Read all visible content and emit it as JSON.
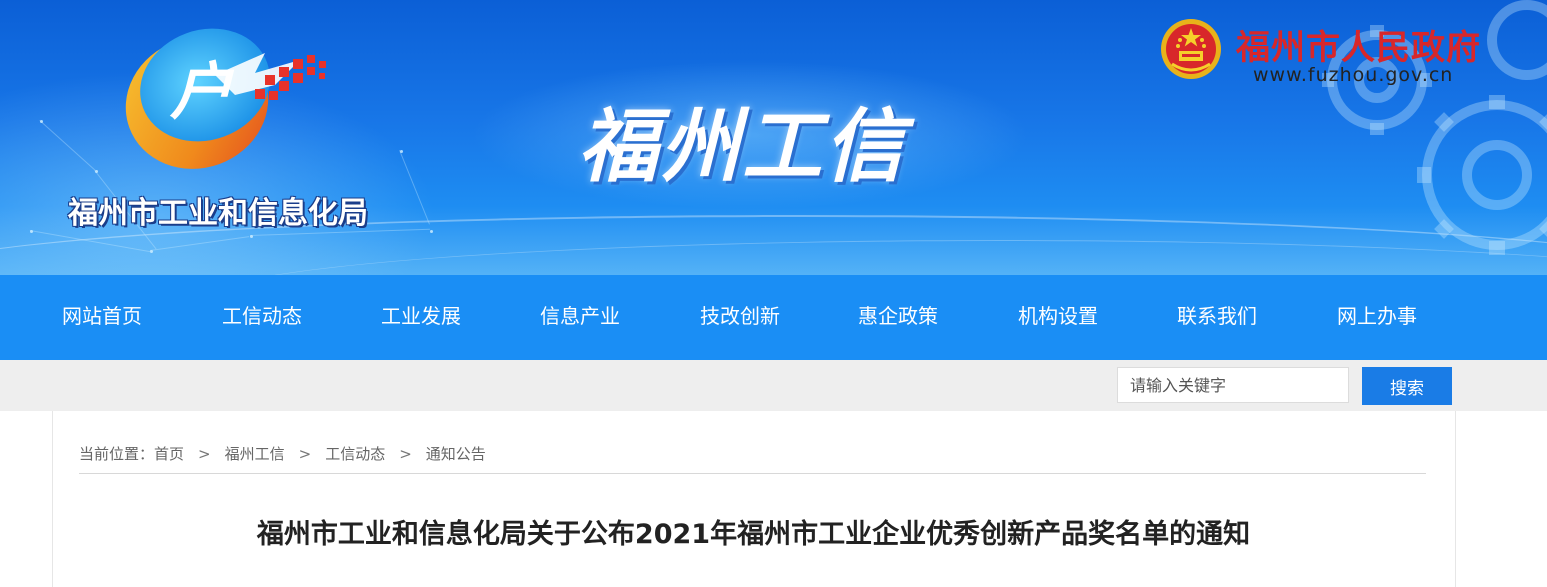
{
  "header": {
    "logo_text": "福州市工业和信息化局",
    "site_title": "福州工信",
    "gov_name": "福州市人民政府",
    "gov_url": "www.fuzhou.gov.cn"
  },
  "nav": {
    "items": [
      {
        "label": "网站首页"
      },
      {
        "label": "工信动态"
      },
      {
        "label": "工业发展"
      },
      {
        "label": "信息产业"
      },
      {
        "label": "技改创新"
      },
      {
        "label": "惠企政策"
      },
      {
        "label": "机构设置"
      },
      {
        "label": "联系我们"
      },
      {
        "label": "网上办事"
      }
    ]
  },
  "search": {
    "placeholder": "请输入关键字",
    "button_label": "搜索"
  },
  "breadcrumb": {
    "prefix": "当前位置：",
    "items": [
      "首页",
      "福州工信",
      "工信动态",
      "通知公告"
    ],
    "separator": ">"
  },
  "article": {
    "title": "福州市工业和信息化局关于公布2021年福州市工业企业优秀创新产品奖名单的通知"
  },
  "colors": {
    "nav_bg": "#1a8ef5",
    "search_button": "#1a7ce6",
    "gov_red": "#d8272a"
  }
}
